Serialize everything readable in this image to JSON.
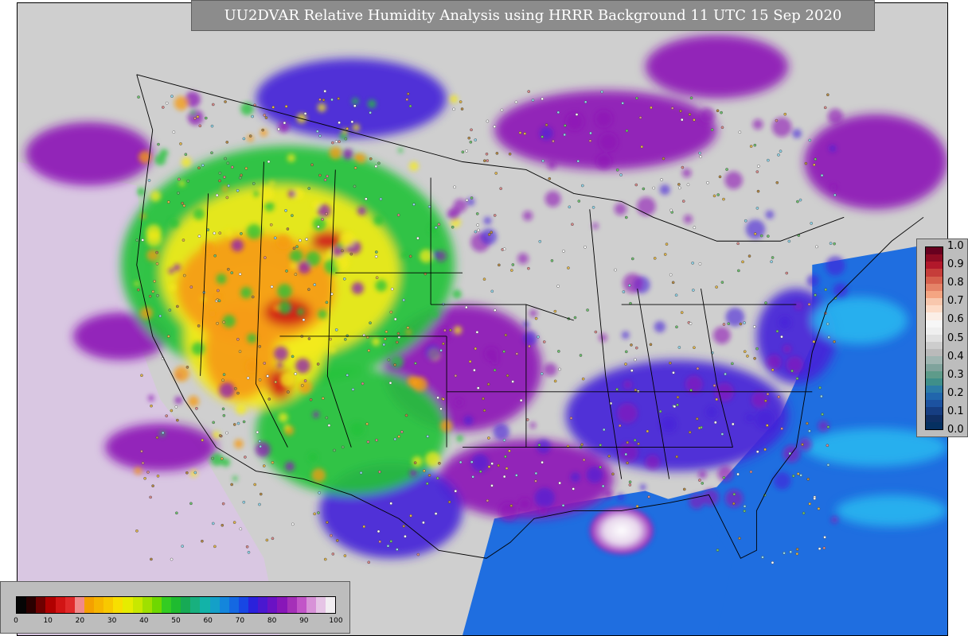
{
  "title": "UU2DVAR Relative Humidity Analysis using HRRR Background 11 UTC 15 Sep 2020",
  "colors": {
    "land_moist": "#cfcfcf",
    "ocean_blue": "#1f6ee0",
    "ocean_cyan": "#27b4ef",
    "purple": "#8d18b6",
    "violet": "#4422d8",
    "green": "#23c23a",
    "yellow": "#f4ea1a",
    "orange": "#f59b13",
    "red": "#cf1a1a",
    "boundary": "#000000"
  },
  "rh_colorbar": {
    "ticks": [
      "0",
      "10",
      "20",
      "30",
      "40",
      "50",
      "60",
      "70",
      "80",
      "90",
      "100"
    ],
    "colors": [
      "#050505",
      "#2a0000",
      "#6e0000",
      "#b00000",
      "#d11414",
      "#e02a2a",
      "#f08a8a",
      "#f4a000",
      "#f6b500",
      "#f8c800",
      "#f8df00",
      "#e6ec00",
      "#c8e800",
      "#9fe000",
      "#6fd800",
      "#33cc22",
      "#1fbb30",
      "#17aa55",
      "#18b07e",
      "#12b3a8",
      "#14a0c8",
      "#1486dc",
      "#1468e2",
      "#1747e4",
      "#2a22dc",
      "#4a18d0",
      "#6a12c4",
      "#8816b8",
      "#a530b8",
      "#c255c8",
      "#d892d8",
      "#e6c4e6",
      "#f2eef2"
    ]
  },
  "increment_colorbar": {
    "ticks": [
      "1.0",
      "0.9",
      "0.8",
      "0.7",
      "0.6",
      "0.5",
      "0.4",
      "0.3",
      "0.2",
      "0.1",
      "0.0"
    ],
    "colors": [
      "#67001f",
      "#8e0b23",
      "#b2182b",
      "#c63d3a",
      "#d6604d",
      "#e58368",
      "#f4a582",
      "#f8c7ad",
      "#fddbc7",
      "#fbeee6",
      "#f7f7f7",
      "#efefef",
      "#e0e0e0",
      "#cdcdcd",
      "#bababa",
      "#9fb5b1",
      "#7fa39c",
      "#5e9b8a",
      "#3f8f8a",
      "#2c7ca7",
      "#2166ac",
      "#1c52a0",
      "#163e82",
      "#0f2f64",
      "#053061"
    ]
  },
  "map_icon": "globe-icon"
}
